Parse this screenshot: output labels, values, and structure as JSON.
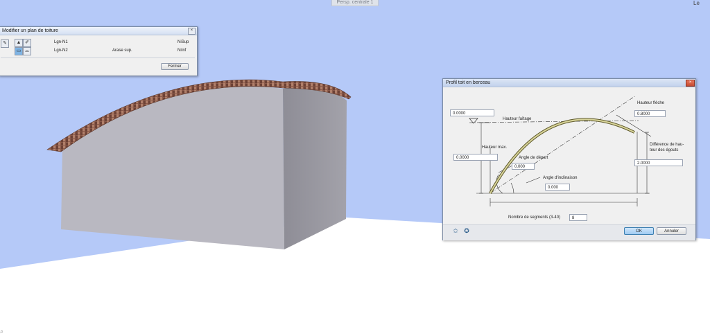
{
  "viewport": {
    "tab_label": "Persp. centrale 1",
    "corner_mark": "Le",
    "bottom_icon": "search-icon"
  },
  "toiture_panel": {
    "title": "Modifier un plan de toiture",
    "rows": [
      {
        "level": "Lgn-N1",
        "type": "",
        "code": "NiSup"
      },
      {
        "level": "Lgn-N2",
        "type": "Arase sup.",
        "code": "NiInf"
      }
    ],
    "close_label": "Fermer"
  },
  "profil_dialog": {
    "title": "Profil toit en berceau",
    "labels": {
      "hauteur_fleche": "Hauteur flèche",
      "hauteur_faitage": "Hauteur faîtage",
      "hauteur_max": "Hauteur max.",
      "angle_depart": "Angle de départ",
      "angle_inclinaison": "Angle d'inclinaison",
      "difference": "Différence de hau-\nteur des égouts",
      "nombre_segments": "Nombre de segments (3-40)"
    },
    "values": {
      "hauteur_faitage": "0.0000",
      "hauteur_fleche": "0.8000",
      "hauteur_max": "0.0000",
      "angle_depart": "0.000",
      "angle_inclinaison": "0.000",
      "difference": "2.0000",
      "nombre_segments": "8"
    },
    "ok_label": "OK",
    "cancel_label": "Annuler"
  },
  "colors": {
    "sky": "#b5c9f8",
    "ground": "#ffffff",
    "wall_front": "#b9b8c1",
    "wall_side": "#95949d",
    "roof": "#8a5a4a"
  }
}
